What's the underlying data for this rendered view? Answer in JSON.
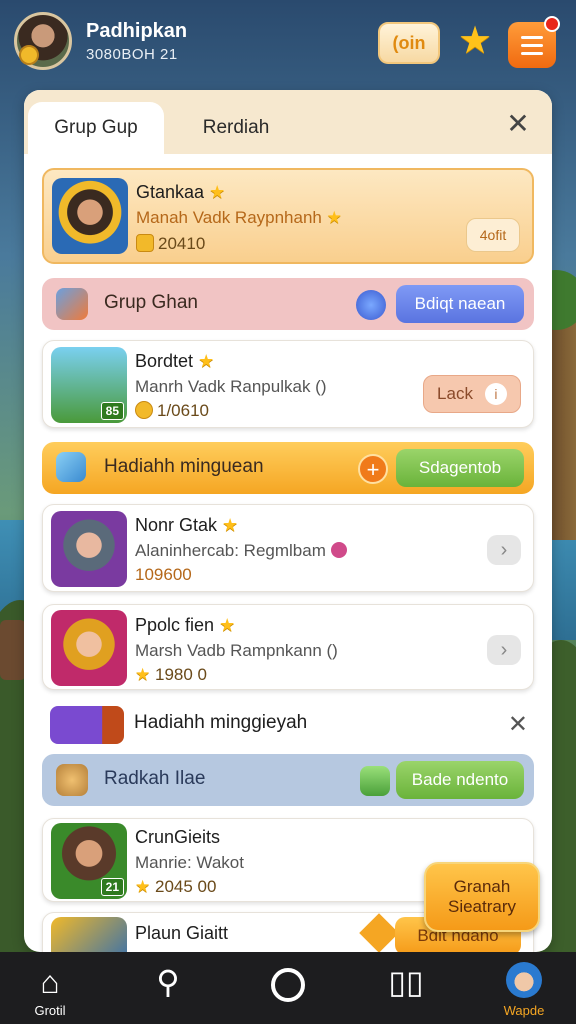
{
  "player": {
    "name": "Padhipkan",
    "id": "3080BOH 21"
  },
  "topbar": {
    "coin_label": "(oin"
  },
  "panel": {
    "tabs": [
      {
        "label": "Grup Gup"
      },
      {
        "label": "Rerdiah"
      }
    ]
  },
  "hero": {
    "name": "Gtankaa",
    "subtitle": "Manah Vadk Raypnhanh",
    "value": "20410",
    "button": "4ofit"
  },
  "sections": [
    {
      "label": "Grup Ghan",
      "button": "Bdiqt naean"
    },
    {
      "label": "Hadiahh minguean",
      "button": "Sdagentob"
    },
    {
      "label": "Hadiahh minggieyah"
    },
    {
      "label": "Radkah Ilae",
      "button": "Bade ndento"
    }
  ],
  "items": [
    {
      "name": "Bordtet",
      "subtitle": "Manrh Vadk Ranpulkak ()",
      "value": "1/0610",
      "level": "85",
      "button": "Lack"
    },
    {
      "name": "Nonr Gtak",
      "subtitle": "Alaninhercab: Regmlbam",
      "value": "109600"
    },
    {
      "name": "Ppolc fien",
      "subtitle": "Marsh Vadb Rampnkann ()",
      "value": "1980 0"
    },
    {
      "name": "CrunGieits",
      "subtitle": "Manrie: Wakot",
      "value": "2045 00",
      "level": "21"
    },
    {
      "name": "Plaun Giaitt",
      "button": "Bdit ndano"
    }
  ],
  "float_button": {
    "line1": "Granah",
    "line2": "Sieatrary"
  },
  "bottomnav": [
    {
      "label": "Grotil",
      "icon": "home-icon"
    },
    {
      "label": "",
      "icon": "search-icon"
    },
    {
      "label": "",
      "icon": "circle-icon"
    },
    {
      "label": "",
      "icon": "cards-icon"
    },
    {
      "label": "Wapde",
      "icon": "profile-avatar-icon"
    }
  ]
}
